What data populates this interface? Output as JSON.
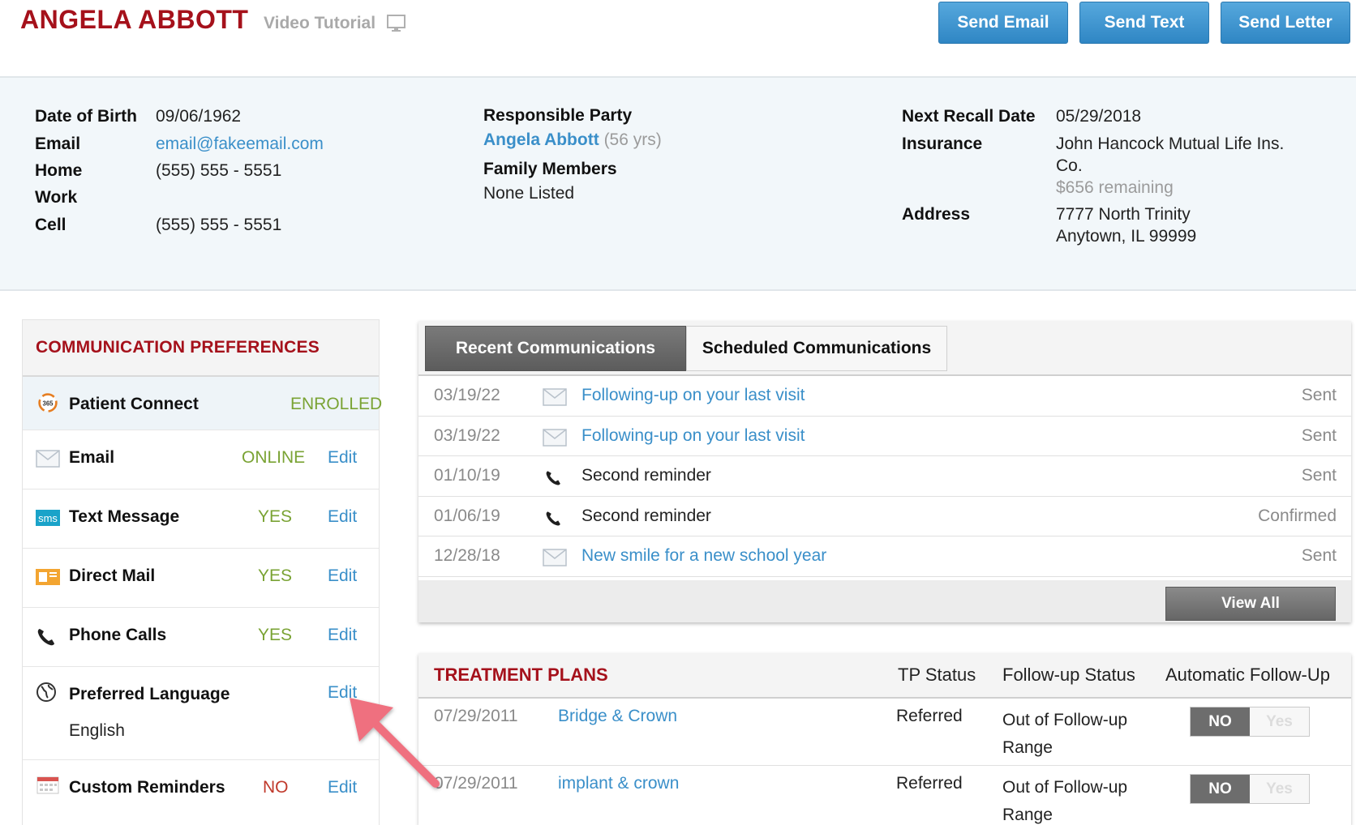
{
  "header": {
    "patient_name": "ANGELA ABBOTT",
    "video_tutorial": "Video Tutorial",
    "buttons": {
      "send_email": "Send Email",
      "send_text": "Send Text",
      "send_letter": "Send Letter"
    }
  },
  "info": {
    "dob_label": "Date of Birth",
    "dob": "09/06/1962",
    "email_label": "Email",
    "email": "email@fakeemail.com",
    "home_label": "Home",
    "home": "(555) 555 - 5551",
    "work_label": "Work",
    "cell_label": "Cell",
    "cell": "(555) 555 - 5551",
    "responsible_label": "Responsible Party",
    "responsible_name": "Angela Abbott",
    "responsible_age": "(56 yrs)",
    "family_label": "Family Members",
    "family_value": "None Listed",
    "recall_label": "Next Recall Date",
    "recall": "05/29/2018",
    "insurance_label": "Insurance",
    "insurance_line1": "John Hancock Mutual Life Ins.",
    "insurance_line2": "Co.",
    "insurance_remaining": "$656 remaining",
    "address_label": "Address",
    "address_line1": "7777 North Trinity",
    "address_line2": "Anytown, IL 99999"
  },
  "prefs": {
    "title": "COMMUNICATION PREFERENCES",
    "rows": [
      {
        "label": "Patient Connect",
        "status": "ENROLLED",
        "edit": ""
      },
      {
        "label": "Email",
        "status": "ONLINE",
        "edit": "Edit"
      },
      {
        "label": "Text Message",
        "status": "YES",
        "edit": "Edit"
      },
      {
        "label": "Direct Mail",
        "status": "YES",
        "edit": "Edit"
      },
      {
        "label": "Phone Calls",
        "status": "YES",
        "edit": "Edit"
      },
      {
        "label": "Preferred Language",
        "status": "",
        "edit": "Edit",
        "sub": "English"
      },
      {
        "label": "Custom Reminders",
        "status": "NO",
        "edit": "Edit"
      }
    ],
    "sms_text": "sms",
    "pc_text": "365"
  },
  "comms": {
    "tab_recent": "Recent Communications",
    "tab_scheduled": "Scheduled Communications",
    "rows": [
      {
        "date": "03/19/22",
        "type": "email",
        "subject": "Following-up on your last visit",
        "status": "Sent"
      },
      {
        "date": "03/19/22",
        "type": "email",
        "subject": "Following-up on your last visit",
        "status": "Sent"
      },
      {
        "date": "01/10/19",
        "type": "phone",
        "subject": "Second reminder",
        "status": "Sent"
      },
      {
        "date": "01/06/19",
        "type": "phone",
        "subject": "Second reminder",
        "status": "Confirmed"
      },
      {
        "date": "12/28/18",
        "type": "email",
        "subject": "New smile for a new school year",
        "status": "Sent"
      }
    ],
    "view_all": "View All"
  },
  "treatment": {
    "title": "TREATMENT PLANS",
    "col_status": "TP Status",
    "col_follow": "Follow-up Status",
    "col_auto": "Automatic Follow-Up",
    "rows": [
      {
        "date": "07/29/2011",
        "name": "Bridge & Crown",
        "status": "Referred",
        "follow": "Out of Follow-up Range",
        "no": "NO",
        "yes": "Yes"
      },
      {
        "date": "07/29/2011",
        "name": "implant & crown",
        "status": "Referred",
        "follow": "Out of Follow-up Range",
        "no": "NO",
        "yes": "Yes"
      }
    ]
  },
  "colors": {
    "brand_red": "#a5111b",
    "link_blue": "#3a8fc9",
    "status_green": "#7aa334",
    "status_red": "#c0392b",
    "annotation_arrow": "#ef6f7f"
  }
}
